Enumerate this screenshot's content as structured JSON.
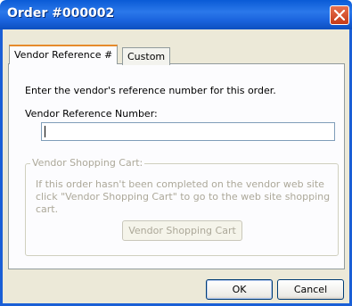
{
  "window": {
    "title": "Order #000002"
  },
  "tabs": [
    {
      "label": "Vendor Reference #"
    },
    {
      "label": "Custom"
    }
  ],
  "vendor_reference": {
    "instruction": "Enter the vendor's reference number for this order.",
    "field_label": "Vendor Reference Number:",
    "field_value": ""
  },
  "shopping_cart": {
    "group_label": "Vendor Shopping Cart:",
    "description": "If this order hasn't been completed on the vendor web site click \"Vendor Shopping Cart\" to go to the web site shopping cart.",
    "button_label": "Vendor Shopping Cart"
  },
  "footer": {
    "ok_label": "OK",
    "cancel_label": "Cancel"
  },
  "colors": {
    "title_bar": "#1a63dd",
    "close_button": "#d5502a",
    "dialog_face": "#ece9d8"
  },
  "icons": {
    "close": "close-x-icon"
  }
}
